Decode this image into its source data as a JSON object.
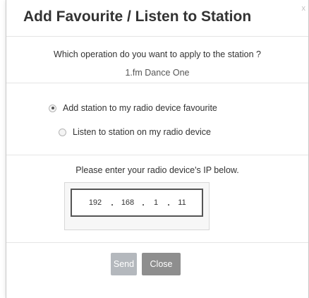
{
  "dialog": {
    "title": "Add Favourite / Listen to Station",
    "close_glyph": "x"
  },
  "question": {
    "text": "Which operation do you want to apply to the station ?",
    "station": "1.fm Dance One"
  },
  "options": [
    {
      "label": "Add station to my radio device favourite",
      "checked": true
    },
    {
      "label": "Listen to station on my radio device",
      "checked": false
    }
  ],
  "ip": {
    "prompt": "Please enter your radio device's IP below.",
    "octets": [
      "192",
      "168",
      "1",
      "11"
    ],
    "separator": "."
  },
  "buttons": {
    "send": "Send",
    "close": "Close"
  },
  "colors": {
    "send_button": "#b4b8bd",
    "close_button": "#8e8e8e"
  }
}
